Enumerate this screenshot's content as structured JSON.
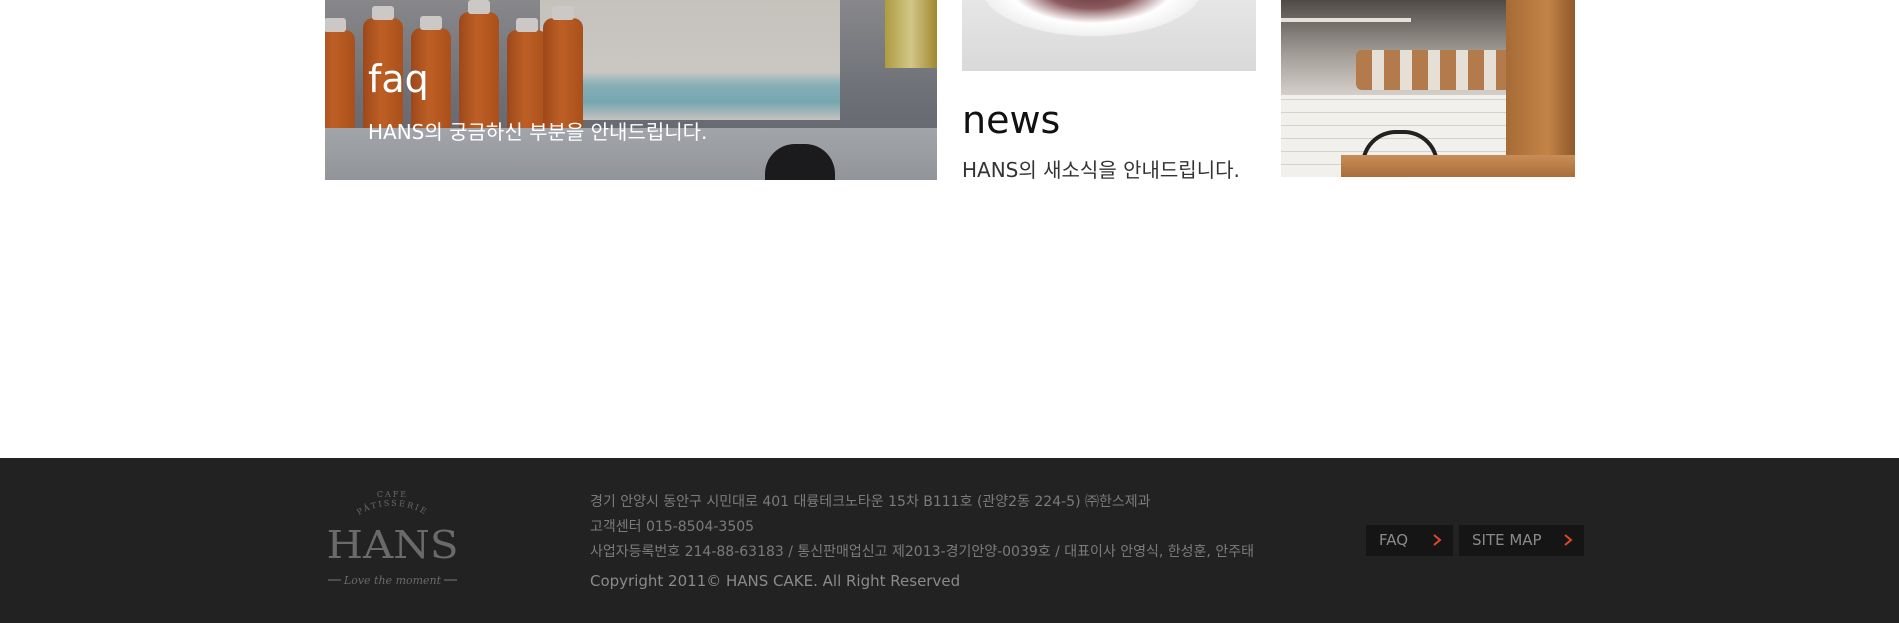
{
  "cards": {
    "faq": {
      "title": "faq",
      "desc": "HANS의 궁금하신 부분을 안내드립니다."
    },
    "news": {
      "title": "news",
      "desc": "HANS의 새소식을 안내드립니다."
    }
  },
  "footer": {
    "logo": {
      "top_text": "CAFE",
      "arc_text": "PÂTISSERIE",
      "brand": "HANS",
      "tagline": "Love the moment"
    },
    "address": "경기 안양시 동안구 시민대로 401 대륭테크노타운 15차 B111호 (관양2동 224-5) ㈜한스제과",
    "customer_center": "고객센터 015-8504-3505",
    "registration": "사업자등록번호 214-88-63183 / 통신판매업신고 제2013-경기안양-0039호 / 대표이사 안영식, 한성훈, 안주태",
    "copyright": "Copyright 2011© HANS CAKE. All Right Reserved",
    "buttons": {
      "faq": "FAQ",
      "sitemap": "SITE MAP"
    }
  },
  "colors": {
    "footer_bg": "#222222",
    "footer_text": "#7b7b7b",
    "button_bg": "#151515",
    "chevron": "#e2452b"
  },
  "icons": {
    "button_chevron": "chevron-right-icon"
  }
}
